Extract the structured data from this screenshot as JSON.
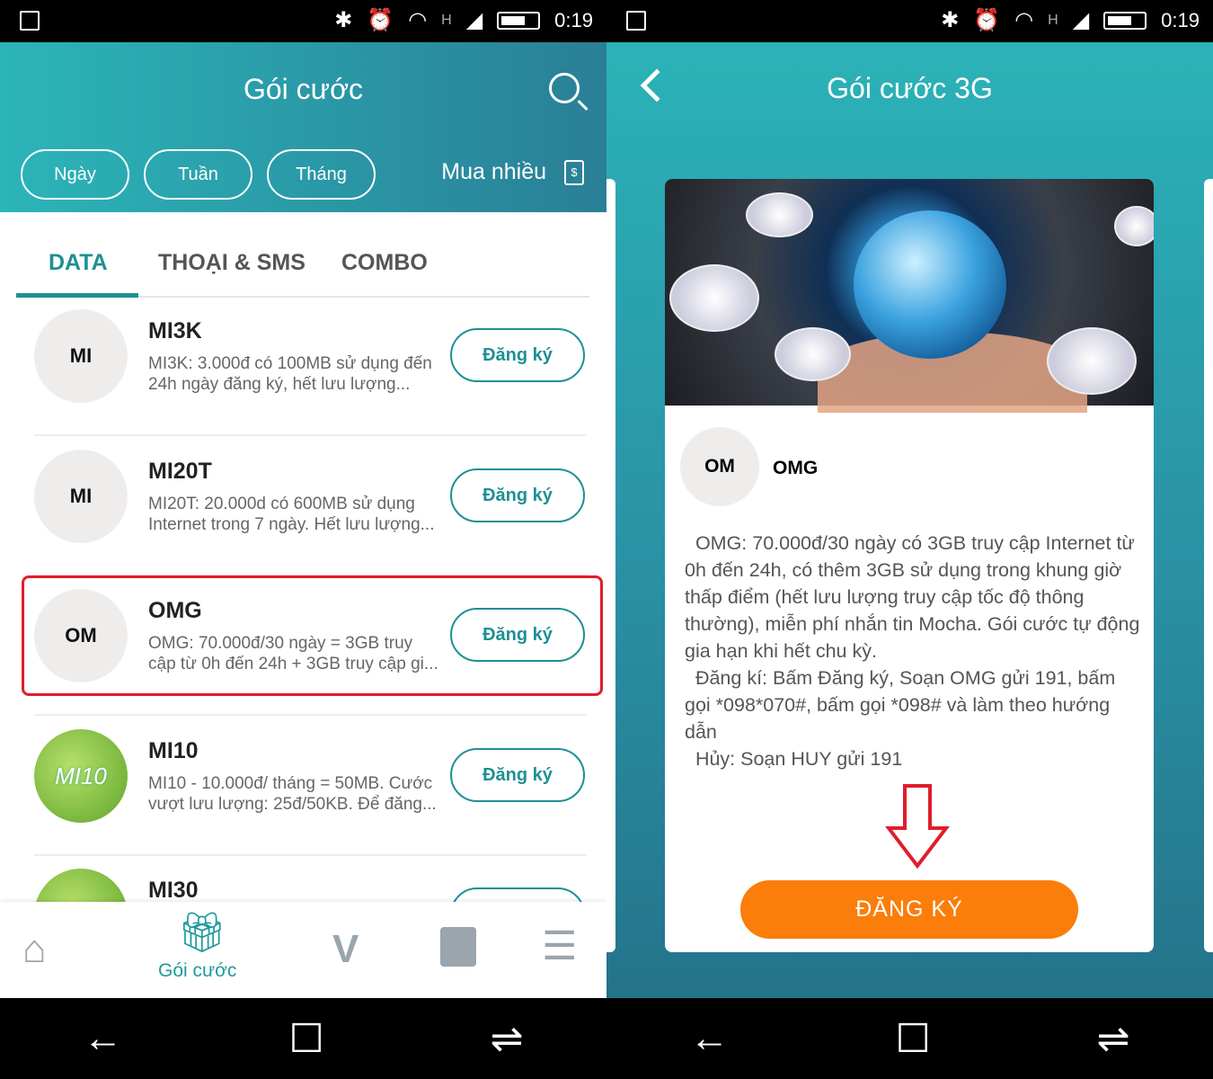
{
  "status_bar": {
    "time": "0:19",
    "network": "H"
  },
  "left": {
    "header": {
      "title": "Gói cước",
      "periods": [
        "Ngày",
        "Tuần",
        "Tháng"
      ],
      "buy_more": "Mua nhiều",
      "bag_symbol": "$"
    },
    "tabs": [
      "DATA",
      "THOẠI & SMS",
      "COMBO"
    ],
    "active_tab": "DATA",
    "packages": [
      {
        "avatar": "MI",
        "name": "MI3K",
        "desc": "MI3K: 3.000đ có 100MB sử dụng đến 24h ngày đăng ký, hết lưu lượng...",
        "button": "Đăng ký"
      },
      {
        "avatar": "MI",
        "name": "MI20T",
        "desc": "MI20T: 20.000d có 600MB sử dụng Internet trong 7 ngày. Hết lưu lượng...",
        "button": "Đăng ký"
      },
      {
        "avatar": "OM",
        "name": "OMG",
        "desc": "OMG: 70.000đ/30 ngày = 3GB truy cập từ 0h đến 24h + 3GB truy cập gi...",
        "button": "Đăng ký"
      },
      {
        "avatar": "MI10",
        "name": "MI10",
        "desc": "MI10 - 10.000đ/ tháng = 50MB. Cước vượt lưu lượng: 25đ/50KB. Để đăng...",
        "button": "Đăng ký"
      },
      {
        "avatar": "",
        "name": "MI30",
        "desc": "",
        "button": ""
      }
    ],
    "bottom_nav": {
      "active_label": "Gói cước"
    },
    "highlight_color": "#e01e2b"
  },
  "right": {
    "title": "Gói cước 3G",
    "package": {
      "avatar": "OM",
      "name": "OMG",
      "desc": "  OMG: 70.000đ/30 ngày có 3GB truy cập Internet từ 0h đến 24h, có thêm 3GB sử dụng trong khung giờ thấp điểm (hết lưu lượng truy cập tốc độ thông thường), miễn phí nhắn tin Mocha. Gói cước tự động gia hạn khi hết chu kỳ.\n  Đăng kí: Bấm Đăng ký, Soạn OMG gửi 191, bấm gọi *098*070#, bấm gọi *098# và làm theo hướng dẫn\n  Hủy: Soạn HUY gửi 191"
    },
    "register_button": "ĐĂNG KÝ",
    "accent": "#fb7d0a"
  }
}
